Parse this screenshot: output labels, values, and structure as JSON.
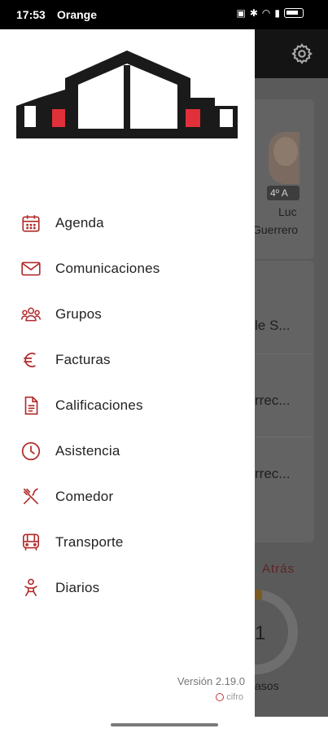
{
  "status_bar": {
    "time": "17:53",
    "carrier": "Orange",
    "icons": [
      "nfc-icon",
      "bluetooth-icon",
      "wifi-icon",
      "signal-icon",
      "battery-icon"
    ]
  },
  "drawer": {
    "menu": [
      {
        "label": "Agenda",
        "icon": "calendar-icon"
      },
      {
        "label": "Comunicaciones",
        "icon": "mail-icon"
      },
      {
        "label": "Grupos",
        "icon": "group-icon"
      },
      {
        "label": "Facturas",
        "icon": "euro-icon"
      },
      {
        "label": "Calificaciones",
        "icon": "document-icon"
      },
      {
        "label": "Asistencia",
        "icon": "clock-icon"
      },
      {
        "label": "Comedor",
        "icon": "utensils-icon"
      },
      {
        "label": "Transporte",
        "icon": "bus-icon"
      },
      {
        "label": "Diarios",
        "icon": "baby-icon"
      }
    ],
    "version": "Versión 2.19.0",
    "brand": "cifro"
  },
  "background": {
    "grade": "4º A",
    "student_first": "Luc",
    "student_last": "Guerrero",
    "row1": "le S...",
    "row2": "rrec...",
    "row3": "rrec...",
    "atras": "Atrás",
    "ring_value": "1",
    "pasos": "asos"
  },
  "colors": {
    "accent": "#b12a2a",
    "logo_dark": "#1a1a1a",
    "logo_red": "#e0303a"
  }
}
